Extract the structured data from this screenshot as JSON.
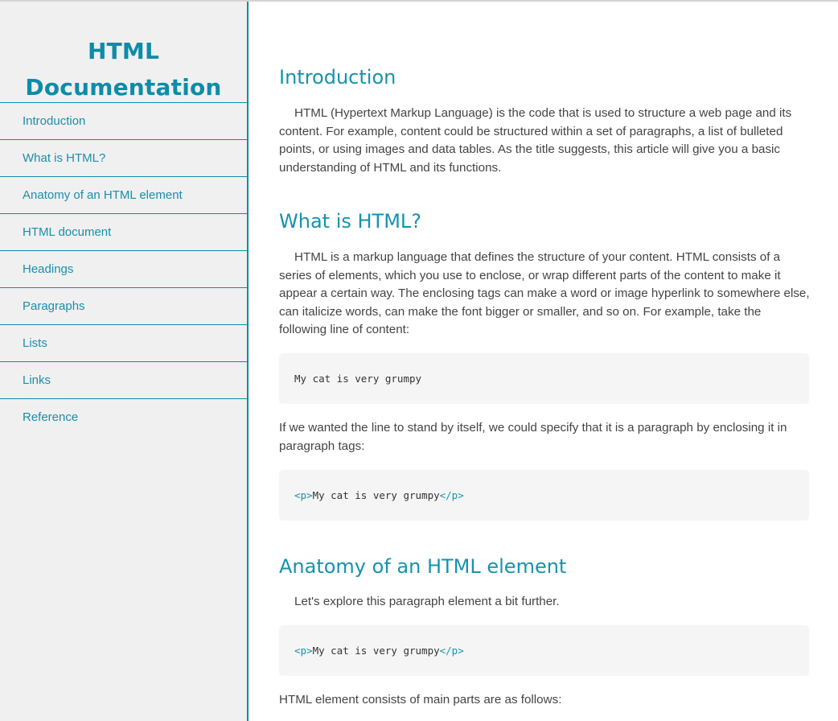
{
  "navbar": {
    "title_line1": "HTML",
    "title_line2": "Documentation",
    "items": [
      {
        "label": "Introduction"
      },
      {
        "label": "What is HTML?"
      },
      {
        "label": "Anatomy of an HTML element"
      },
      {
        "label": "HTML document"
      },
      {
        "label": "Headings"
      },
      {
        "label": "Paragraphs"
      },
      {
        "label": "Lists"
      },
      {
        "label": "Links"
      },
      {
        "label": "Reference"
      }
    ]
  },
  "main": {
    "sections": [
      {
        "heading": "Introduction",
        "paragraph": "HTML (Hypertext Markup Language) is the code that is used to structure a web page and its content. For example, content could be structured within a set of paragraphs, a list of bulleted points, or using images and data tables. As the title suggests, this article will give you a basic understanding of HTML and its functions."
      },
      {
        "heading": "What is HTML?",
        "paragraph": "HTML is a markup language that defines the structure of your content. HTML consists of a series of elements, which you use to enclose, or wrap different parts of the content to make it appear a certain way. The enclosing tags can make a word or image hyperlink to somewhere else, can italicize words, can make the font bigger or smaller, and so on. For example, take the following line of content:",
        "code1": "My cat is very grumpy",
        "paragraph2": "If we wanted the line to stand by itself, we could specify that it is a paragraph by enclosing it in paragraph tags:",
        "code2": {
          "open_tag": "<p>",
          "text": "My cat is very grumpy",
          "close_tag": "</p>"
        }
      },
      {
        "heading": "Anatomy of an HTML element",
        "paragraph": "Let's explore this paragraph element a bit further.",
        "code": {
          "open_tag": "<p>",
          "text": "My cat is very grumpy",
          "close_tag": "</p>"
        },
        "paragraph2": "HTML element consists of main parts are as follows:"
      }
    ]
  },
  "colors": {
    "accent": "#0d8ca8",
    "sidebar_bg": "#f0f0f0",
    "code_bg": "#f5f5f5",
    "body_text": "#444444"
  }
}
